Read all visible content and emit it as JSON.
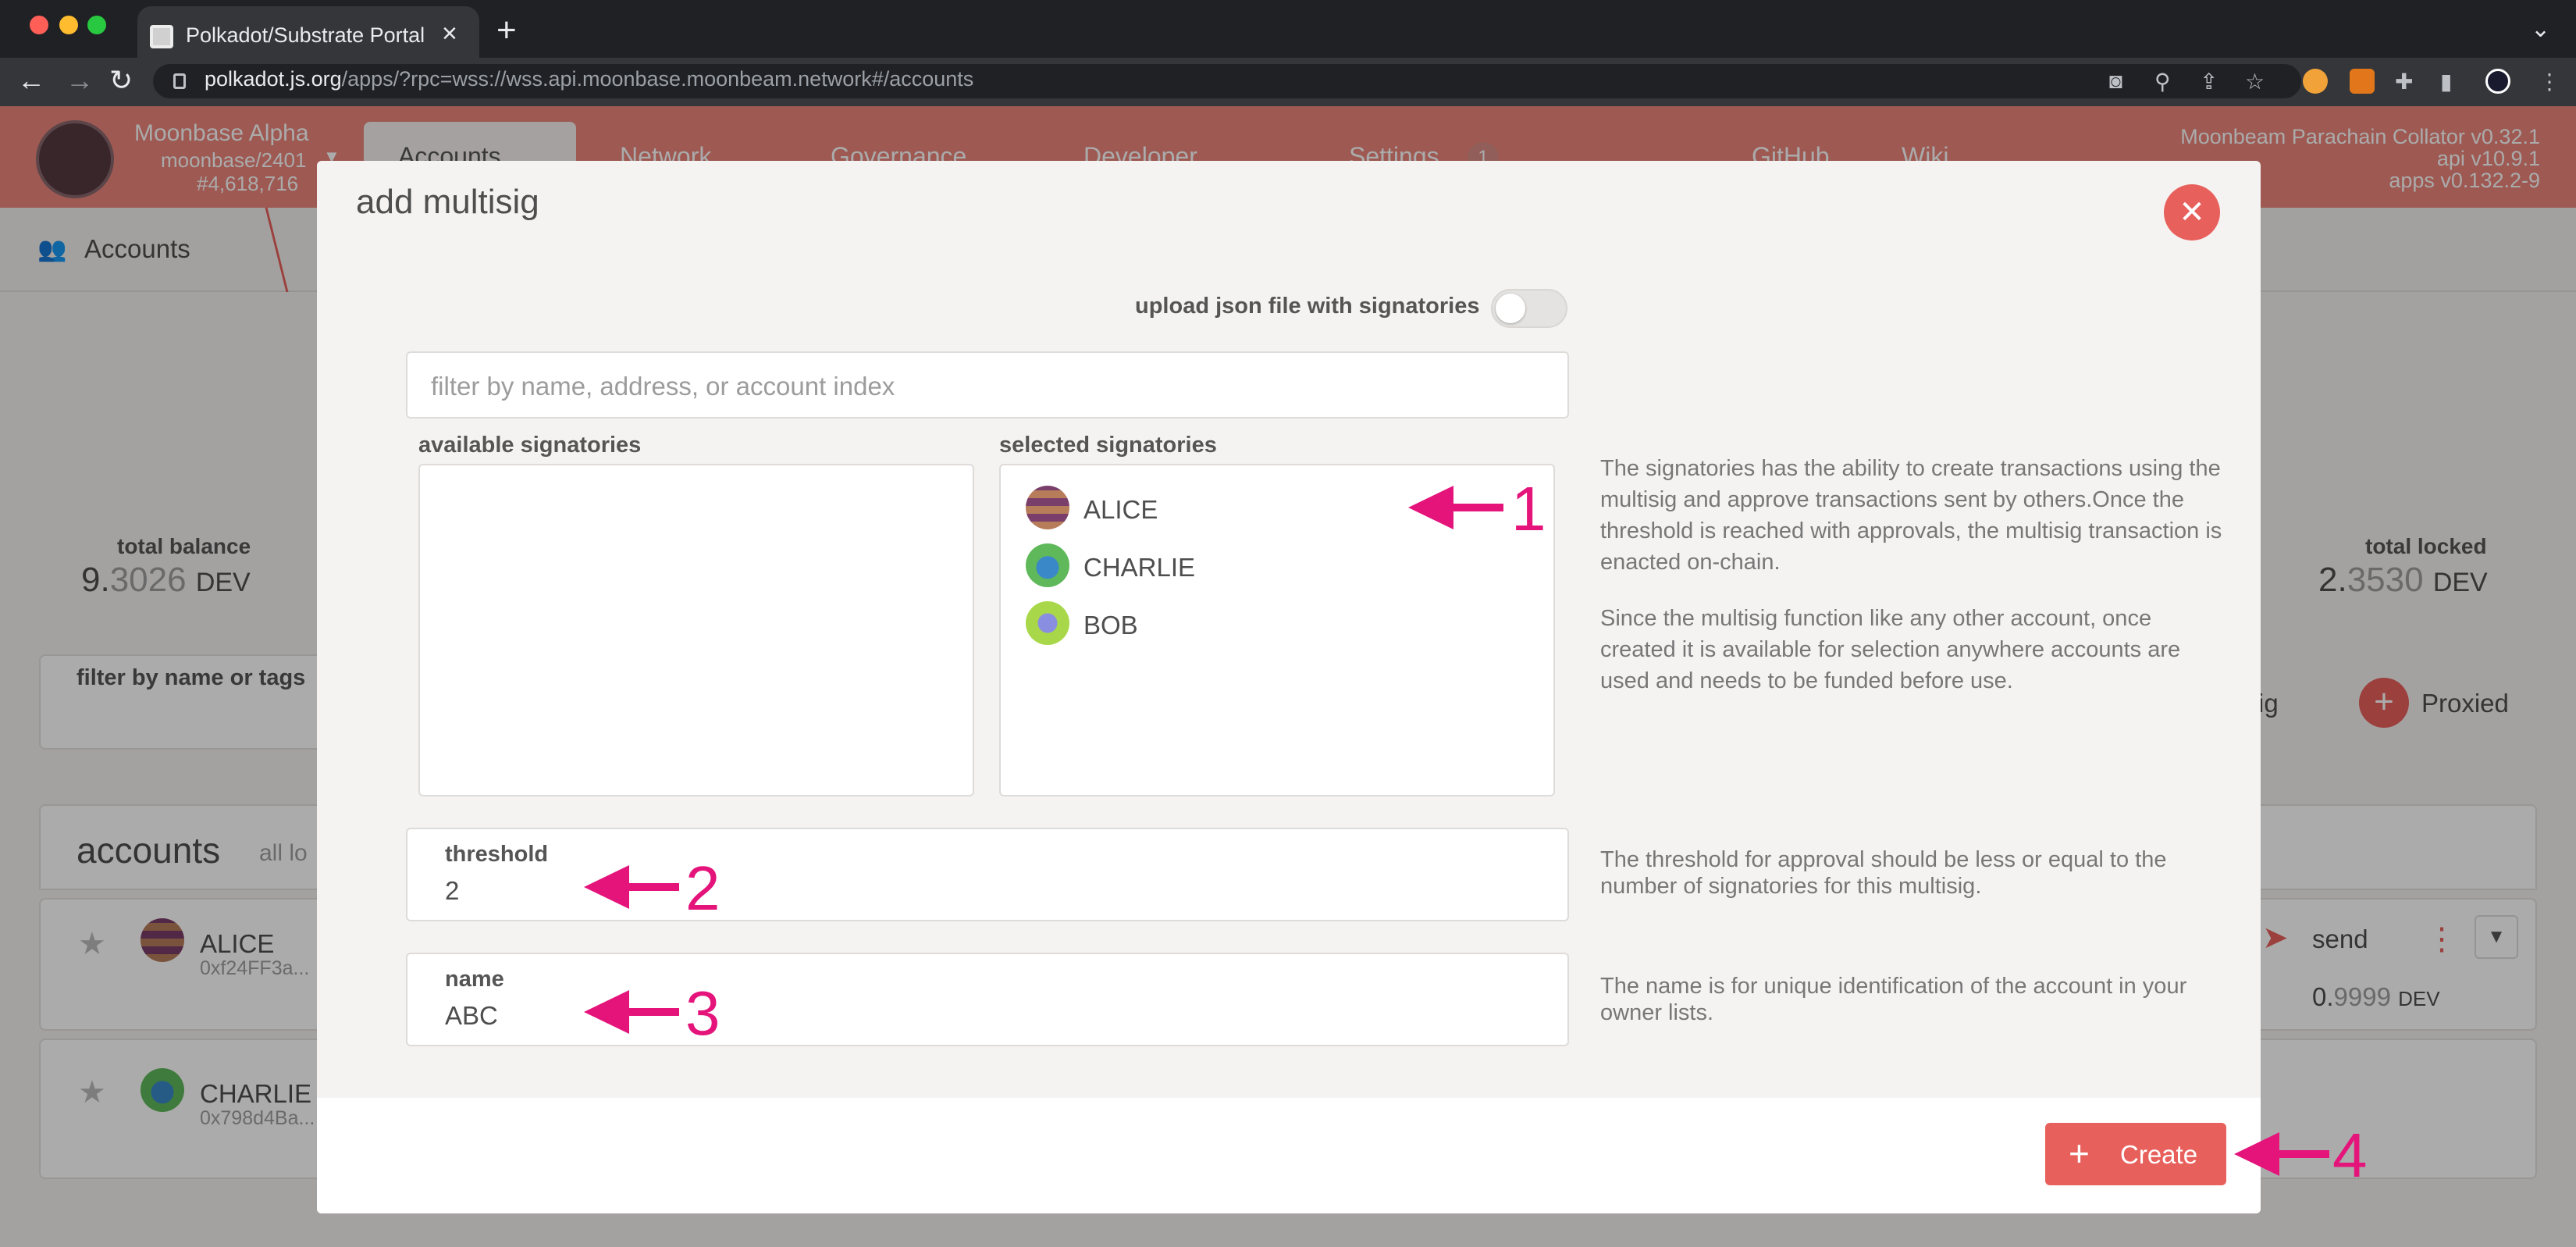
{
  "browser": {
    "tab_title": "Polkadot/Substrate Portal",
    "url_host": "polkadot.js.org",
    "url_path": "/apps/?rpc=wss://wss.api.moonbase.moonbeam.network#/accounts"
  },
  "app": {
    "chain_name": "Moonbase Alpha",
    "chain_spec": "moonbase/2401",
    "block_number": "#4,618,716",
    "nav": [
      "Accounts",
      "Network",
      "Governance",
      "Developer",
      "Settings"
    ],
    "settings_badge": "1",
    "links": [
      "GitHub",
      "Wiki"
    ],
    "version_node": "Moonbeam Parachain Collator v0.32.1",
    "version_api": "api v10.9.1",
    "version_apps": "apps v0.132.2-9",
    "breadcrumb": "Accounts"
  },
  "background": {
    "total_balance_label": "total balance",
    "total_balance_int": "9.",
    "total_balance_dec": "3026",
    "total_balance_unit": "DEV",
    "total_locked_label": "total locked",
    "total_locked_int": "2.",
    "total_locked_dec": "3530",
    "total_locked_unit": "DEV",
    "filter_label": "filter by name or tags",
    "multisig_partial": "tisig",
    "proxied_label": "Proxied",
    "accounts_heading": "accounts",
    "accounts_sub": "all lo",
    "rows": [
      {
        "name": "ALICE",
        "address": "0xf24FF3a..."
      },
      {
        "name": "CHARLIE",
        "address": "0x798d4Ba..."
      }
    ],
    "send_label": "send",
    "row_balance_int": "0.",
    "row_balance_dec": "9999",
    "row_balance_unit": "DEV"
  },
  "modal": {
    "title": "add multisig",
    "close_glyph": "✕",
    "toggle_label": "upload json file with signatories",
    "filter_placeholder": "filter by name, address, or account index",
    "available_label": "available signatories",
    "selected_label": "selected signatories",
    "selected": [
      "ALICE",
      "CHARLIE",
      "BOB"
    ],
    "help_signatories_1": "The signatories has the ability to create transactions using the multisig and approve transactions sent by others.Once the threshold is reached with approvals, the multisig transaction is enacted on-chain.",
    "help_signatories_2": "Since the multisig function like any other account, once created it is available for selection anywhere accounts are used and needs to be funded before use.",
    "threshold_label": "threshold",
    "threshold_value": "2",
    "help_threshold": "The threshold for approval should be less or equal to the number of signatories for this multisig.",
    "name_label": "name",
    "name_value": "ABC",
    "help_name": "The name is for unique identification of the account in your owner lists.",
    "create_label": "Create"
  },
  "annotations": [
    "1",
    "2",
    "3",
    "4"
  ],
  "colors": {
    "accent": "#e8605c",
    "header": "#ea857b",
    "annotation": "#e4147b"
  }
}
